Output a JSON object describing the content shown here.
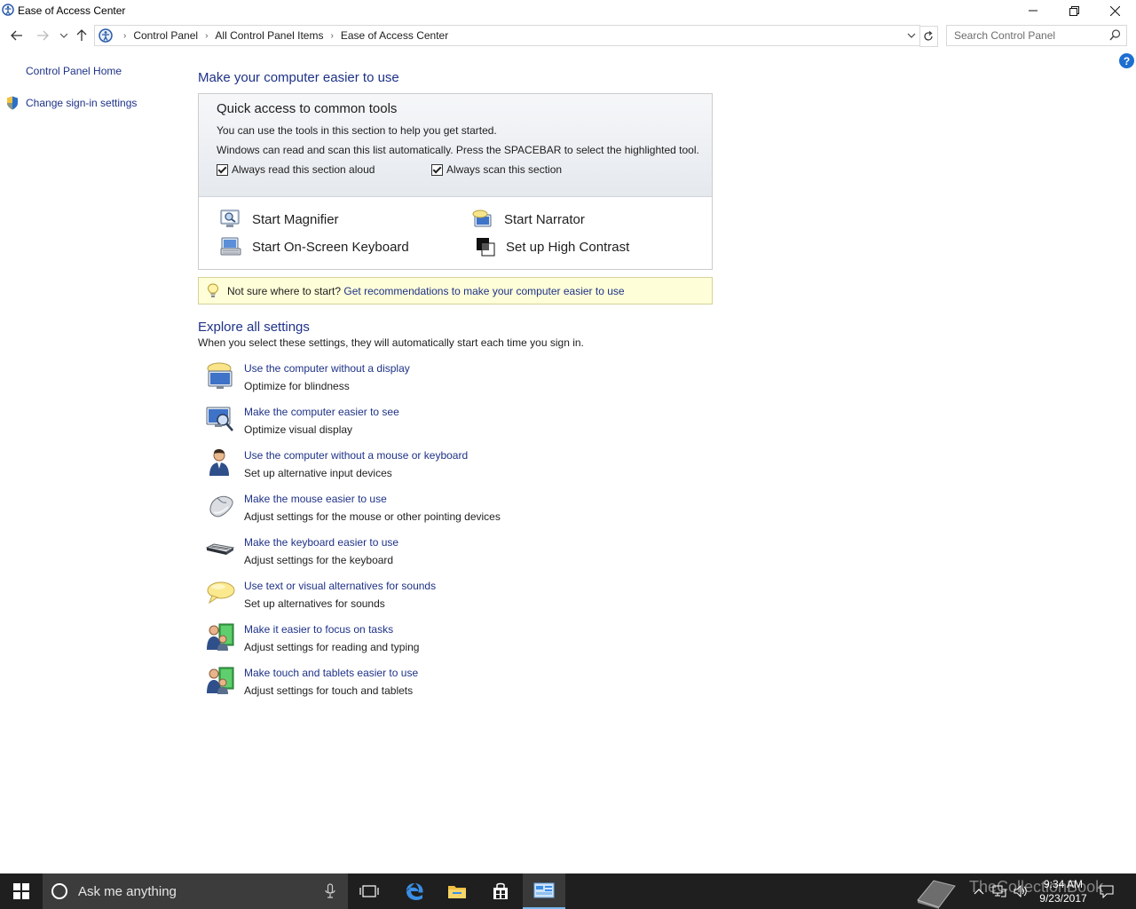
{
  "window": {
    "title": "Ease of Access Center"
  },
  "breadcrumbs": [
    "Control Panel",
    "All Control Panel Items",
    "Ease of Access Center"
  ],
  "search": {
    "placeholder": "Search Control Panel"
  },
  "leftnav": {
    "home": "Control Panel Home",
    "signin": "Change sign-in settings"
  },
  "main": {
    "heading": "Make your computer easier to use",
    "quick": {
      "title": "Quick access to common tools",
      "line1": "You can use the tools in this section to help you get started.",
      "line2": "Windows can read and scan this list automatically.  Press the SPACEBAR to select the highlighted tool.",
      "read_aloud": {
        "label": "Always read this section aloud",
        "checked": true
      },
      "scan": {
        "label": "Always scan this section",
        "checked": true
      },
      "tools": {
        "magnifier": "Start Magnifier",
        "narrator": "Start Narrator",
        "osk": "Start On-Screen Keyboard",
        "high_contrast": "Set up High Contrast"
      }
    },
    "tip": {
      "text": "Not sure where to start?",
      "link": "Get recommendations to make your computer easier to use"
    },
    "explore": {
      "heading": "Explore all settings",
      "desc": "When you select these settings, they will automatically start each time you sign in.",
      "items": [
        {
          "icon": "monitor-speaker-icon",
          "link": "Use the computer without a display",
          "desc": "Optimize for blindness"
        },
        {
          "icon": "monitor-magnifier-icon",
          "link": "Make the computer easier to see",
          "desc": "Optimize visual display"
        },
        {
          "icon": "person-icon",
          "link": "Use the computer without a mouse or keyboard",
          "desc": "Set up alternative input devices"
        },
        {
          "icon": "mouse-icon",
          "link": "Make the mouse easier to use",
          "desc": "Adjust settings for the mouse or other pointing devices"
        },
        {
          "icon": "keyboard-icon",
          "link": "Make the keyboard easier to use",
          "desc": "Adjust settings for the keyboard"
        },
        {
          "icon": "speech-bubble-icon",
          "link": "Use text or visual alternatives for sounds",
          "desc": "Set up alternatives for sounds"
        },
        {
          "icon": "people-board-icon",
          "link": "Make it easier to focus on tasks",
          "desc": "Adjust settings for reading and typing"
        },
        {
          "icon": "people-board-icon",
          "link": "Make touch and tablets easier to use",
          "desc": "Adjust settings for touch and tablets"
        }
      ]
    }
  },
  "taskbar": {
    "cortana_placeholder": "Ask me anything",
    "time": "9:34 AM",
    "date": "9/23/2017",
    "watermark": "TheCollectionBook"
  },
  "colors": {
    "link": "#1e3287",
    "taskbar": "#1f1f1f",
    "tip_bg": "#fefed9"
  }
}
